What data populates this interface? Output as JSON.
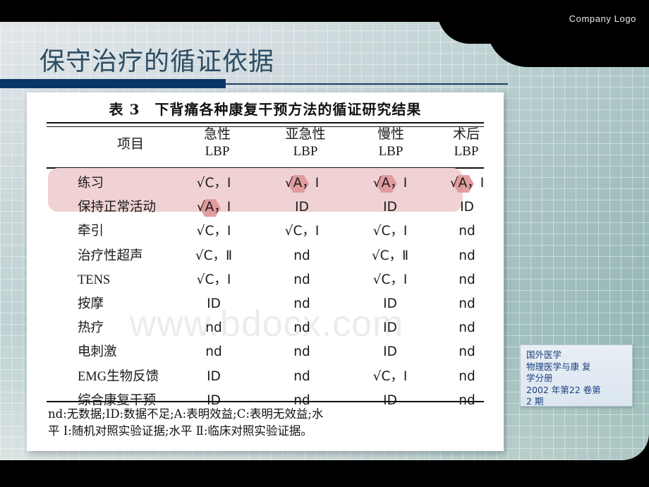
{
  "header": {
    "company_logo": "Company Logo"
  },
  "title": "保守治疗的循证依据",
  "watermark": "www.bdocx.com",
  "table": {
    "caption": "表 3　下背痛各种康复干预方法的循证研究结果",
    "columns": [
      "项目",
      "急性\nLBP",
      "亚急性\nLBP",
      "慢性\nLBP",
      "术后\nLBP"
    ],
    "column_headers": [
      {
        "line1": "项目",
        "line2": ""
      },
      {
        "line1": "急性",
        "line2": "LBP"
      },
      {
        "line1": "亚急性",
        "line2": "LBP"
      },
      {
        "line1": "慢性",
        "line2": "LBP"
      },
      {
        "line1": "术后",
        "line2": "LBP"
      }
    ],
    "rows": [
      {
        "label": "练习",
        "values": [
          "√C，I",
          "√A，I",
          "√A，I",
          "√A，I"
        ],
        "highlight": true
      },
      {
        "label": "保持正常活动",
        "values": [
          "√A，I",
          "ID",
          "ID",
          "ID"
        ],
        "highlight": true
      },
      {
        "label": "牵引",
        "values": [
          "√C，I",
          "√C，I",
          "√C，I",
          "nd"
        ],
        "highlight": false
      },
      {
        "label": "治疗性超声",
        "values": [
          "√C，Ⅱ",
          "nd",
          "√C，Ⅱ",
          "nd"
        ],
        "highlight": false
      },
      {
        "label": "TENS",
        "values": [
          "√C，I",
          "nd",
          "√C，I",
          "nd"
        ],
        "highlight": false
      },
      {
        "label": "按摩",
        "values": [
          "ID",
          "nd",
          "ID",
          "nd"
        ],
        "highlight": false
      },
      {
        "label": "热疗",
        "values": [
          "nd",
          "nd",
          "ID",
          "nd"
        ],
        "highlight": false
      },
      {
        "label": "电刺激",
        "values": [
          "nd",
          "nd",
          "ID",
          "nd"
        ],
        "highlight": false
      },
      {
        "label": "EMG生物反馈",
        "values": [
          "ID",
          "nd",
          "√C，I",
          "nd"
        ],
        "highlight": false
      },
      {
        "label": "综合康复干预",
        "values": [
          "ID",
          "nd",
          "ID",
          "nd"
        ],
        "highlight": false
      }
    ],
    "footnote_line1": "nd:无数据;ID:数据不足;A:表明效益;C:表明无效益;水",
    "footnote_line2": "平 Ⅰ:随机对照实验证据;水平 Ⅱ:临床对照实验证据。"
  },
  "citation": {
    "line1": "国外医学",
    "line2": "物理医学与康 复",
    "line3": "学分册",
    "line4": "2002 年第22 卷第",
    "line5": "2 期"
  },
  "colors": {
    "title_text": "#2d4d63",
    "rule_navy": "#0b3767",
    "highlight_band": "#f0d2d4",
    "hex_marker": "#de9597",
    "citation_text": "#1b3f80"
  }
}
